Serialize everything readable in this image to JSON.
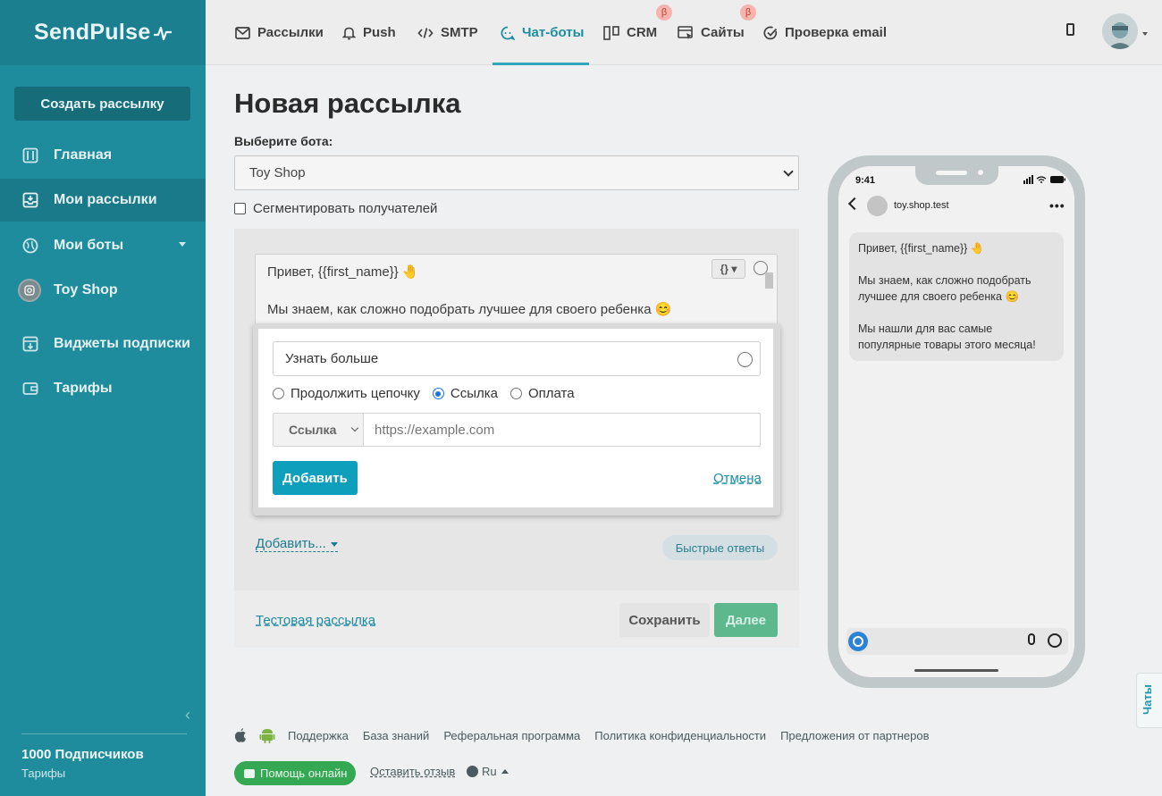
{
  "app": {
    "logo": "SendPulse"
  },
  "sidebar": {
    "create_button": "Создать рассылку",
    "items": [
      {
        "label": "Главная",
        "icon": "sliders-icon"
      },
      {
        "label": "Мои рассылки",
        "icon": "inbox-icon",
        "active": true
      },
      {
        "label": "Мои боты",
        "icon": "globe-icon",
        "has_dropdown": true
      },
      {
        "label": "Toy Shop",
        "icon": "instagram-avatar"
      },
      {
        "label": "Виджеты подписки",
        "icon": "download-box-icon"
      },
      {
        "label": "Тарифы",
        "icon": "wallet-icon"
      }
    ],
    "subscribers": "1000 Подписчиков",
    "tariffs_link": "Тарифы"
  },
  "topnav": {
    "items": [
      {
        "label": "Рассылки",
        "icon": "mail-icon"
      },
      {
        "label": "Push",
        "icon": "bell-icon"
      },
      {
        "label": "SMTP",
        "icon": "code-icon"
      },
      {
        "label": "Чат-боты",
        "icon": "chatbot-icon",
        "active": true
      },
      {
        "label": "CRM",
        "icon": "crm-icon",
        "beta": true
      },
      {
        "label": "Сайты",
        "icon": "site-icon",
        "beta": true
      },
      {
        "label": "Проверка email",
        "icon": "check-circle-icon"
      }
    ],
    "beta_label": "β"
  },
  "main": {
    "title": "Новая рассылка",
    "bot_label": "Выберите бота:",
    "bot_selected": "Toy Shop",
    "segment_label": "Сегментировать получателей",
    "message": {
      "line1": "Привет,  {{first_name}} 🤚",
      "line2": "Мы знаем, как сложно подобрать лучшее для своего ребенка 😊",
      "var_button": "{}"
    },
    "popup": {
      "button_text_value": "Узнать больше",
      "radio_options": [
        "Продолжить цепочку",
        "Ссылка",
        "Оплата"
      ],
      "radio_selected": "Ссылка",
      "link_type": "Ссылка",
      "url_placeholder": "https://example.com",
      "add_button": "Добавить",
      "cancel_link": "Отмена"
    },
    "add_more": "Добавить...",
    "quick_replies": "Быстрые ответы",
    "test_send": "Тестовая рассылка",
    "save_button": "Сохранить",
    "next_button": "Далее"
  },
  "phone": {
    "time": "9:41",
    "contact": "toy.shop.test",
    "bubble": [
      "Привет,  {{first_name}} 🤚",
      "Мы знаем, как сложно подобрать лучшее для своего ребенка 😊",
      "Мы нашли для вас самые популярные товары этого месяца!"
    ]
  },
  "chats_tab": "Чаты",
  "footer": {
    "links": [
      "Поддержка",
      "База знаний",
      "Реферальная программа",
      "Политика конфиденциальности",
      "Предложения от партнеров"
    ],
    "help_online": "Помощь онлайн",
    "leave_review": "Оставить отзыв",
    "language": "Ru"
  },
  "colors": {
    "sidebar_bg": "#1f8c9e",
    "accent": "#0e9fbd",
    "next_button": "#5db88e",
    "help_green": "#35a853"
  }
}
